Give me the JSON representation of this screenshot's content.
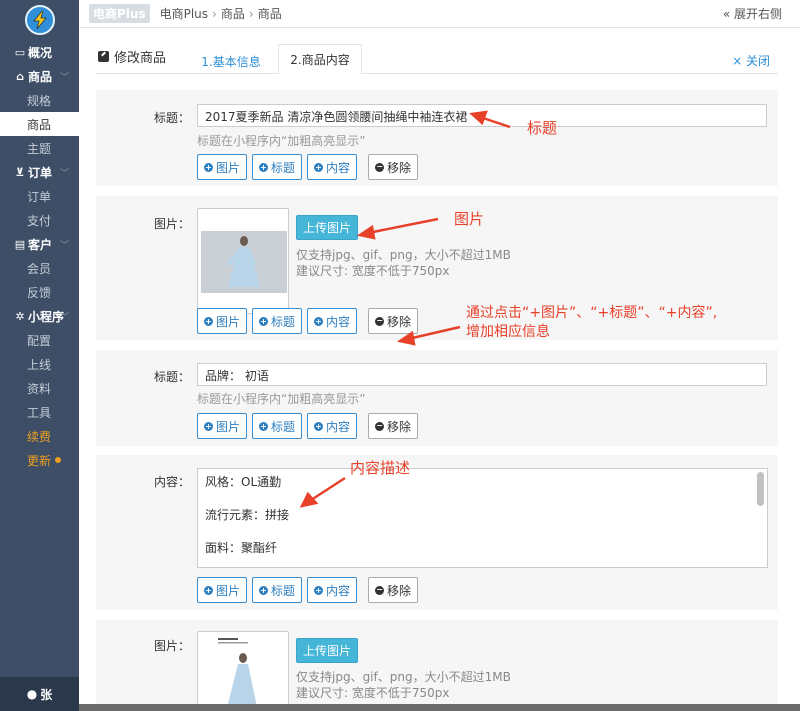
{
  "sidebar": {
    "groups": [
      {
        "label": "概况",
        "icon": "monitor-icon",
        "items": []
      },
      {
        "label": "商品",
        "icon": "bank-icon",
        "items": [
          {
            "label": "规格"
          },
          {
            "label": "商品"
          },
          {
            "label": "主题"
          }
        ]
      },
      {
        "label": "订单",
        "icon": "cart-icon",
        "items": [
          {
            "label": "订单"
          },
          {
            "label": "支付"
          }
        ]
      },
      {
        "label": "客户",
        "icon": "id-card-icon",
        "items": [
          {
            "label": "会员"
          },
          {
            "label": "反馈"
          }
        ]
      },
      {
        "label": "小程序",
        "icon": "cogs-icon",
        "items": [
          {
            "label": "配置"
          },
          {
            "label": "上线"
          },
          {
            "label": "资料"
          },
          {
            "label": "工具"
          },
          {
            "label": "续费"
          },
          {
            "label": "更新"
          }
        ]
      }
    ],
    "user": "张"
  },
  "topbar": {
    "brand_badge": "电商Plus",
    "crumbs": [
      "电商Plus",
      "商品",
      "商品"
    ],
    "expand_right": "展开右侧"
  },
  "panel": {
    "title": "修改商品",
    "tabs": [
      {
        "label": "1.基本信息"
      },
      {
        "label": "2.商品内容"
      }
    ],
    "close": "关闭"
  },
  "blocks": {
    "b1": {
      "label": "标题：",
      "value": "2017夏季新品 清凉净色圆领腰间抽绳中袖连衣裙",
      "hint": "标题在小程序内“加粗高亮显示”"
    },
    "b2": {
      "label": "图片：",
      "upload": "上传图片",
      "hint1": "仅支持jpg、gif、png，大小不超过1MB",
      "hint2": "建议尺寸: 宽度不低于750px"
    },
    "b3": {
      "label": "标题：",
      "value": "品牌： 初语",
      "hint": "标题在小程序内“加粗高亮显示”"
    },
    "b4": {
      "label": "内容：",
      "lines": [
        "风格：OL通勤",
        "流行元素：拼接",
        "面料：聚酯纤"
      ]
    },
    "b5": {
      "label": "图片：",
      "upload": "上传图片",
      "hint1": "仅支持jpg、gif、png，大小不超过1MB",
      "hint2": "建议尺寸: 宽度不低于750px"
    }
  },
  "buttons": {
    "image": "图片",
    "title": "标题",
    "content": "内容",
    "remove": "移除"
  },
  "annotations": {
    "title": "标题",
    "image": "图片",
    "add_line1": "通过点击“+图片”、“+标题”、“+内容”,",
    "add_line2": "增加相应信息",
    "content": "内容描述"
  },
  "colors": {
    "sidebar_bg": "#3d4e66",
    "accent_blue": "#2d8fd5",
    "upload_btn": "#45b5d8",
    "annotation_red": "#e8412a",
    "highlight_orange": "#f0a020"
  }
}
